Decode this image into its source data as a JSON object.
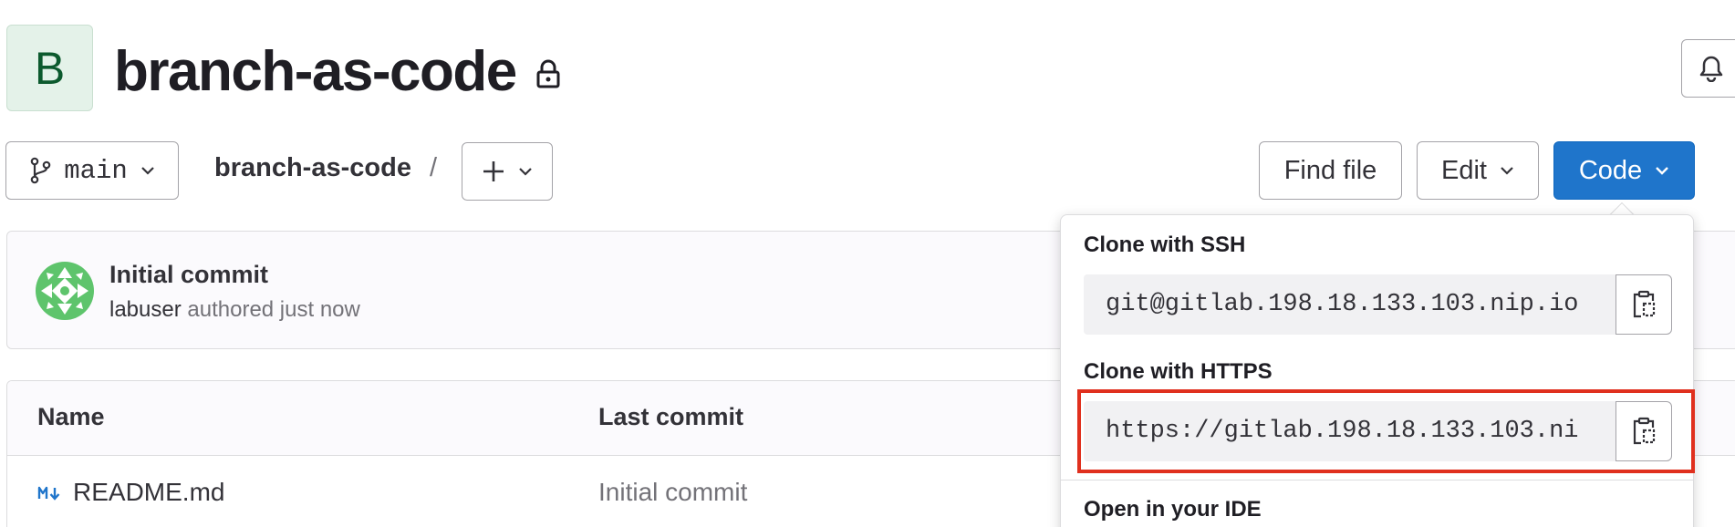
{
  "project": {
    "avatar_letter": "B",
    "title": "branch-as-code"
  },
  "toolbar": {
    "branch": "main",
    "breadcrumb": "branch-as-code",
    "separator": "/",
    "find_file": "Find file",
    "edit": "Edit",
    "code": "Code"
  },
  "commit": {
    "title": "Initial commit",
    "author": "labuser",
    "meta": "authored just now"
  },
  "files": {
    "headers": {
      "name": "Name",
      "last_commit": "Last commit"
    },
    "rows": [
      {
        "name": "README.md",
        "last_commit": "Initial commit",
        "icon": "markdown-icon"
      }
    ]
  },
  "clone": {
    "ssh_label": "Clone with SSH",
    "ssh_url": "git@gitlab.198.18.133.103.nip.io",
    "https_label": "Clone with HTTPS",
    "https_url": "https://gitlab.198.18.133.103.ni",
    "ide_label": "Open in your IDE"
  },
  "colors": {
    "primary": "#1f75cb",
    "avatar_bg": "#e4f2e9",
    "highlight": "#e0301e"
  }
}
